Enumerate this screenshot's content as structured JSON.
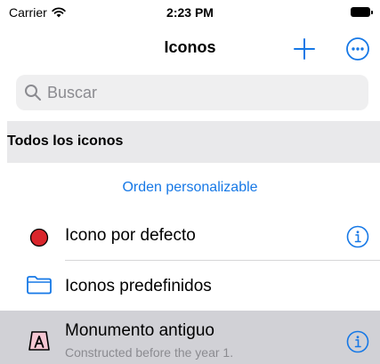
{
  "status_bar": {
    "carrier": "Carrier",
    "time": "2:23 PM"
  },
  "nav": {
    "title": "Iconos",
    "add_icon": "plus-icon",
    "more_icon": "ellipsis-circle-icon"
  },
  "search": {
    "placeholder": "Buscar",
    "icon": "magnifier-icon"
  },
  "section": {
    "title": "Todos los iconos"
  },
  "order_link": "Orden personalizable",
  "rows": [
    {
      "label": "Icono por defecto",
      "icon": "red-circle-icon",
      "has_info": true
    },
    {
      "label": "Iconos predefinidos",
      "icon": "folder-icon",
      "has_info": false
    },
    {
      "label": "Monumento antiguo",
      "subtitle": "Constructed before the year 1.",
      "icon": "letter-a-icon",
      "has_info": true,
      "selected": true
    }
  ],
  "colors": {
    "accent": "#1678e6",
    "dot_red": "#d9262c",
    "selected_bg": "#d1d1d6",
    "header_bg": "#e9e9eb",
    "glyph_fill": "#f5c6d2"
  }
}
